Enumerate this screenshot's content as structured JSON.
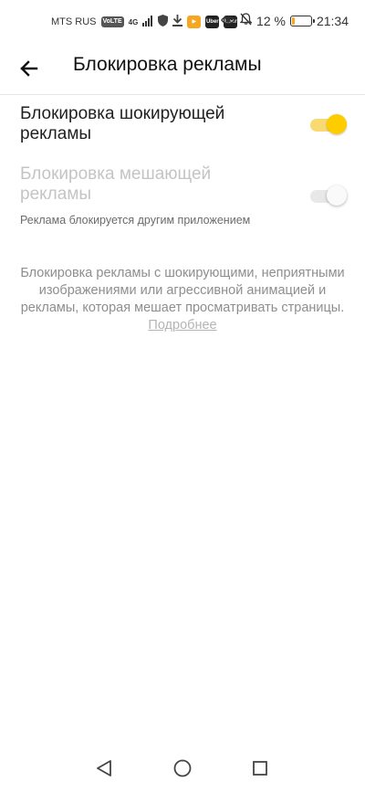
{
  "status_bar": {
    "carrier": "MTS RUS",
    "volte_badge": "VoLTE",
    "network": "4G",
    "app_icons": [
      {
        "name": "shield-icon"
      },
      {
        "name": "download-icon"
      },
      {
        "name": "play-app-icon",
        "color": "#f5a623"
      },
      {
        "name": "uber-app-icon",
        "label": "Uber",
        "color": "#222222"
      },
      {
        "name": "uber-app-icon-2",
        "label": "Uber",
        "color": "#222222"
      }
    ],
    "more": "···",
    "battery_percent": "12 %",
    "battery_level": 0.12,
    "time": "21:34"
  },
  "app_bar": {
    "title": "Блокировка рекламы"
  },
  "settings": [
    {
      "label": "Блокировка шокирующей рекламы",
      "enabled": true,
      "checked": true
    },
    {
      "label": "Блокировка мешающей рекламы",
      "enabled": false,
      "checked": false
    }
  ],
  "sub_note": "Реклама блокируется другим приложением",
  "description": {
    "text": "Блокировка рекламы с шокирующими, неприятными изображениями или агрессивной анимацией и рекламы, которая мешает просматривать страницы.",
    "link": "Подробнее"
  },
  "colors": {
    "accent": "#ffcc00",
    "accent_track": "#f9da72",
    "disabled_text": "#c4c4c4"
  },
  "nav_bar": {
    "back": "back-triangle-icon",
    "home": "home-circle-icon",
    "recents": "recents-square-icon"
  }
}
